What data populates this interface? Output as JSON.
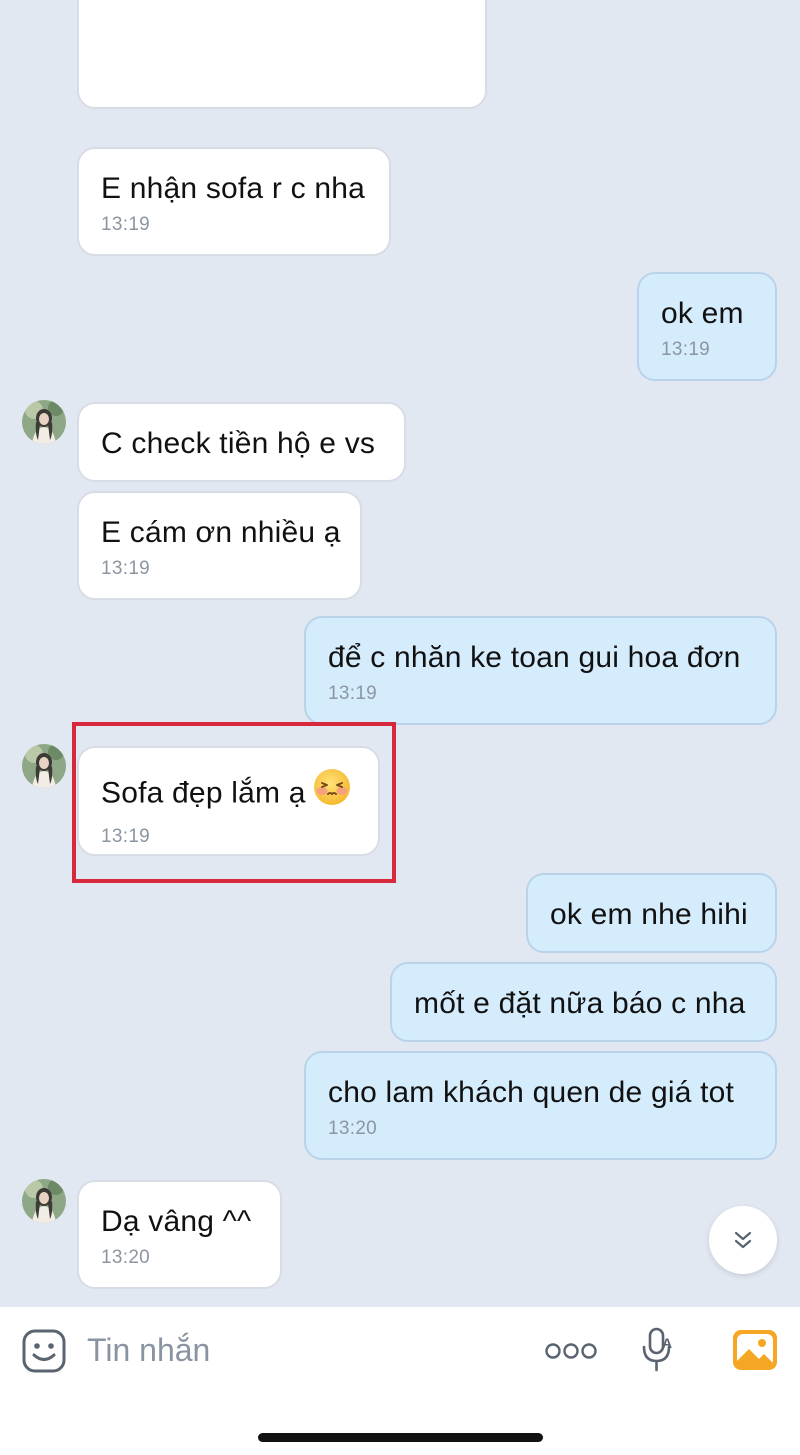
{
  "messages": [
    {
      "id": "m1",
      "direction": "incoming",
      "text": "E nhận sofa r c nha",
      "time": "13:19"
    },
    {
      "id": "m2",
      "direction": "outgoing",
      "text": "ok em",
      "time": "13:19"
    },
    {
      "id": "m3",
      "direction": "incoming",
      "text": "C check tiền hộ e vs",
      "time": ""
    },
    {
      "id": "m4",
      "direction": "incoming",
      "text": "E cám ơn nhiều ạ",
      "time": "13:19"
    },
    {
      "id": "m5",
      "direction": "outgoing",
      "text": "để c nhăn ke toan gui hoa đơn",
      "time": "13:19"
    },
    {
      "id": "m6",
      "direction": "incoming",
      "text": "Sofa đẹp lắm ạ",
      "time": "13:19",
      "emoji": "blushing-face-icon",
      "highlighted": true
    },
    {
      "id": "m7",
      "direction": "outgoing",
      "text": "ok em nhe hihi",
      "time": ""
    },
    {
      "id": "m8",
      "direction": "outgoing",
      "text": "mốt e đặt nữa báo c nha",
      "time": ""
    },
    {
      "id": "m9",
      "direction": "outgoing",
      "text": "cho lam khách quen de giá tot",
      "time": "13:20"
    },
    {
      "id": "m10",
      "direction": "incoming",
      "text": "Dạ vâng ^^",
      "time": "13:20"
    }
  ],
  "input_bar": {
    "placeholder": "Tin nhắn",
    "icons": [
      "sticker-face-icon",
      "more-dots-icon",
      "voice-to-text-mic-icon",
      "gallery-image-icon"
    ]
  },
  "scroll_button": {
    "icon": "double-chevron-down-icon"
  },
  "colors": {
    "background": "#e2e8f2",
    "incoming_bubble": "#ffffff",
    "outgoing_bubble": "#d5ecfd",
    "timestamp": "#8c96a3",
    "highlight": "#d8283c",
    "gallery_icon": "#f5a623"
  }
}
